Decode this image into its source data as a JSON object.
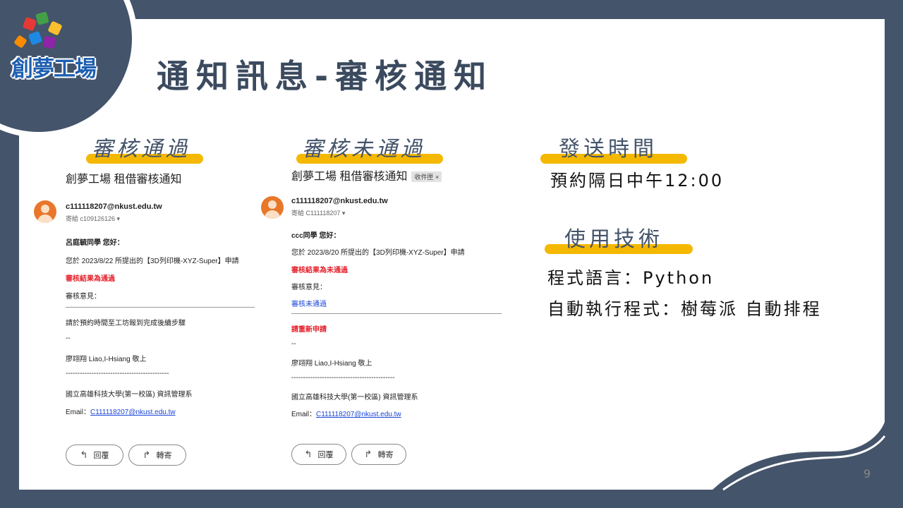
{
  "page_title": "通知訊息-審核通知",
  "logo_text": "創夢工場",
  "sections": {
    "approved": "審核通過",
    "rejected": "審核未通過",
    "send_time": "發送時間",
    "tech": "使用技術"
  },
  "email_approved": {
    "subject": "創夢工場 租借審核通知",
    "sender": "c111118207@nkust.edu.tw",
    "to": "寄給 c109126126 ▾",
    "greeting": "呂庭毓同學 您好：",
    "body1": "您於 2023/8/22 所提出的【3D列印機-XYZ-Super】申請",
    "result": "審核結果為通過",
    "opinion_label": "審核意見：",
    "instruction": "請於預約時間至工坊報到完成後續步驟",
    "sep1": "--",
    "signature": "廖翊翔 Liao,I-Hsiang 敬上",
    "sep2": "--------------------------------------------",
    "org": "國立高雄科技大學(第一校區) 資訊管理系",
    "email_label": "Email：",
    "email_link": "C111118207@nkust.edu.tw",
    "reply": "回覆",
    "forward": "轉寄"
  },
  "email_rejected": {
    "subject": "創夢工場 租借審核通知",
    "inbox_tag": "收件匣 ×",
    "sender": "c111118207@nkust.edu.tw",
    "to": "寄給 C111118207 ▾",
    "greeting": "ccc同學 您好：",
    "body1": "您於 2023/8/20 所提出的【3D列印機-XYZ-Super】申請",
    "result": "審核結果為未通過",
    "opinion_label": "審核意見：",
    "opinion": "審核未通過",
    "reapply": "請重新申請",
    "sep1": "--",
    "signature": "廖翊翔 Liao,I-Hsiang 敬上",
    "sep2": "--------------------------------------------",
    "org": "國立高雄科技大學(第一校區) 資訊管理系",
    "email_label": "Email：",
    "email_link": "C111118207@nkust.edu.tw",
    "reply": "回覆",
    "forward": "轉寄"
  },
  "send_time_value": "預約隔日中午12:00",
  "tech_lang": "程式語言：Python",
  "tech_exec": "自動執行程式：樹莓派 自動排程",
  "page_number": "9",
  "colors": {
    "frame": "#44546a",
    "highlight": "#f5b800",
    "red_text": "#e5202a",
    "link_blue": "#1a45d6",
    "avatar": "#e8772a"
  }
}
